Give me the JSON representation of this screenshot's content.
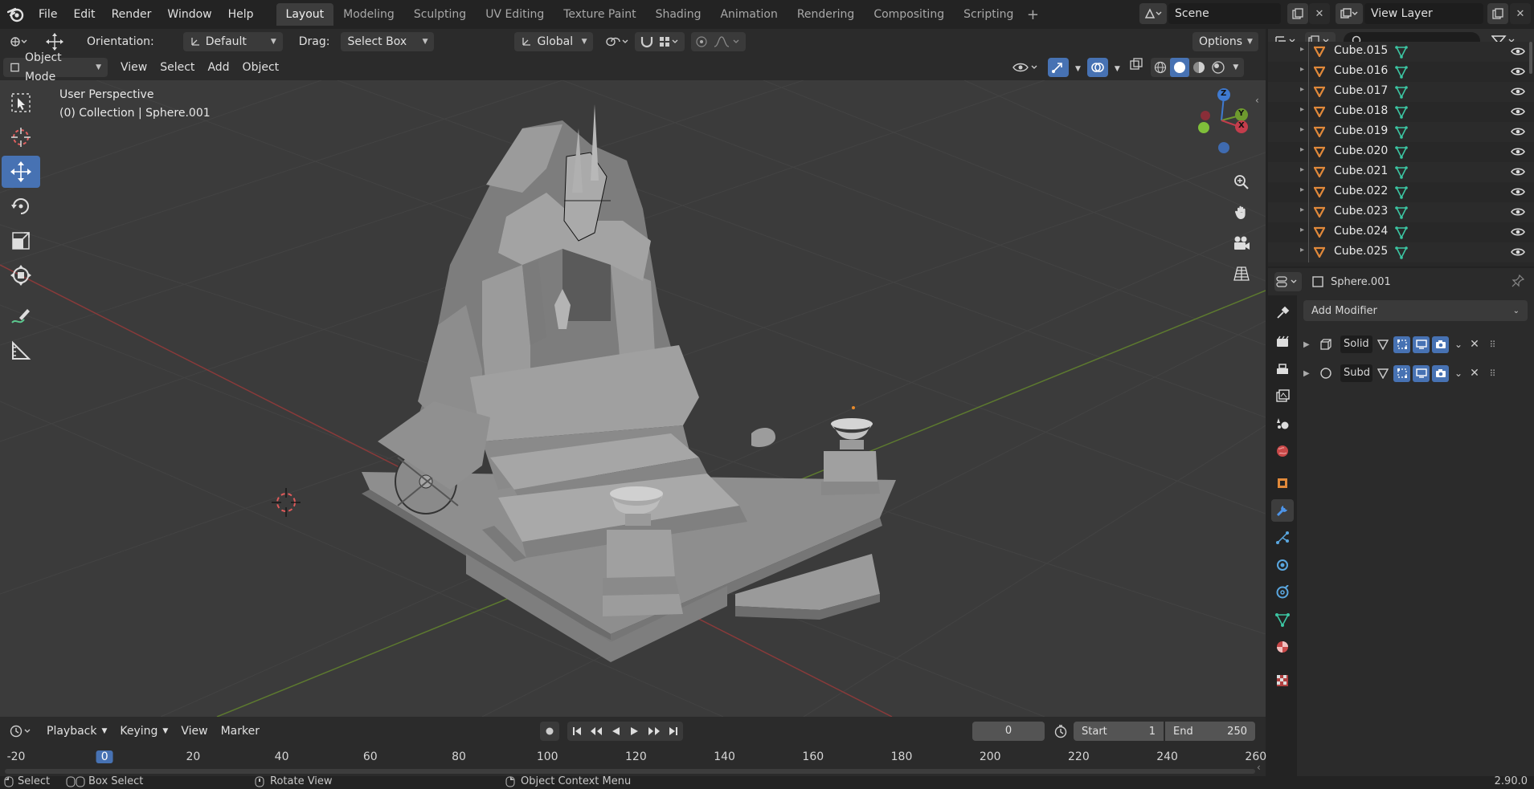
{
  "menu": [
    "File",
    "Edit",
    "Render",
    "Window",
    "Help"
  ],
  "workspaces": [
    "Layout",
    "Modeling",
    "Sculpting",
    "UV Editing",
    "Texture Paint",
    "Shading",
    "Animation",
    "Rendering",
    "Compositing",
    "Scripting"
  ],
  "active_workspace": "Layout",
  "scene": "Scene",
  "view_layer": "View Layer",
  "header": {
    "orientation_label": "Orientation:",
    "orientation_value": "Default",
    "drag_label": "Drag:",
    "drag_value": "Select Box",
    "transform_orientation": "Global",
    "options": "Options",
    "mode": "Object Mode",
    "menus": [
      "View",
      "Select",
      "Add",
      "Object"
    ]
  },
  "viewport": {
    "perspective": "User Perspective",
    "collection": "(0) Collection | Sphere.001",
    "gizmo_axes": [
      "Z",
      "Y",
      "X"
    ]
  },
  "outliner": {
    "items": [
      "Cube.015",
      "Cube.016",
      "Cube.017",
      "Cube.018",
      "Cube.019",
      "Cube.020",
      "Cube.021",
      "Cube.022",
      "Cube.023",
      "Cube.024",
      "Cube.025"
    ]
  },
  "properties": {
    "object_name": "Sphere.001",
    "add_modifier": "Add Modifier",
    "modifiers": [
      "Solid",
      "Subd"
    ]
  },
  "timeline": {
    "menus": [
      "Playback",
      "Keying",
      "View",
      "Marker"
    ],
    "current_frame": "0",
    "start_label": "Start",
    "start_value": "1",
    "end_label": "End",
    "end_value": "250",
    "ticks": [
      "-20",
      "0",
      "20",
      "40",
      "60",
      "80",
      "100",
      "120",
      "140",
      "160",
      "180",
      "200",
      "220",
      "240",
      "260"
    ]
  },
  "statusbar": {
    "select": "Select",
    "box_select": "Box Select",
    "rotate_view": "Rotate View",
    "context_menu": "Object Context Menu",
    "version": "2.90.0"
  },
  "colors": {
    "accent": "#4772b3",
    "x_axis": "#c33d4c",
    "y_axis": "#6e9a2e",
    "z_axis": "#3f7ad0",
    "mesh_icon": "#e1893a",
    "data_icon": "#3cc6a3"
  }
}
